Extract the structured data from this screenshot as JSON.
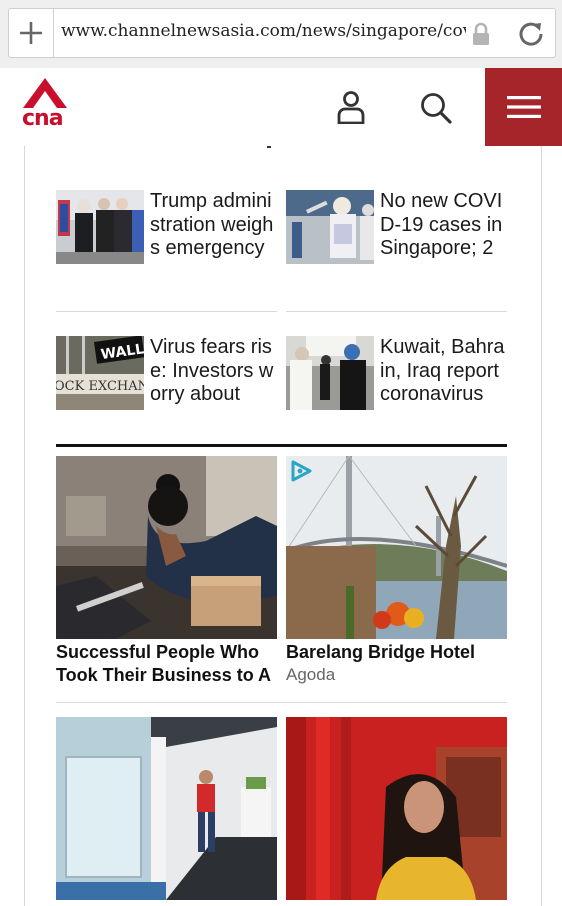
{
  "browser": {
    "url": "www.channelnewsasia.com/news/singapore/covi"
  },
  "header": {
    "logo_text": "cna",
    "brand_color": "#c8102e",
    "menu_color": "#a6252b"
  },
  "news": [
    {
      "title": "Trump administration weighs emergency"
    },
    {
      "title": "No new COVID-19 cases in Singapore; 2"
    },
    {
      "title": "Virus fears rise: Investors worry about"
    },
    {
      "title": "Kuwait, Bahrain, Iraq report coronavirus"
    }
  ],
  "sponsored": [
    {
      "title": "Successful People Who Took Their Business to A",
      "source": ""
    },
    {
      "title": "Barelang Bridge Hotel",
      "source": "Agoda"
    }
  ],
  "wall_sign": "WALL",
  "exchange_sign": "OCK EXCHAN"
}
